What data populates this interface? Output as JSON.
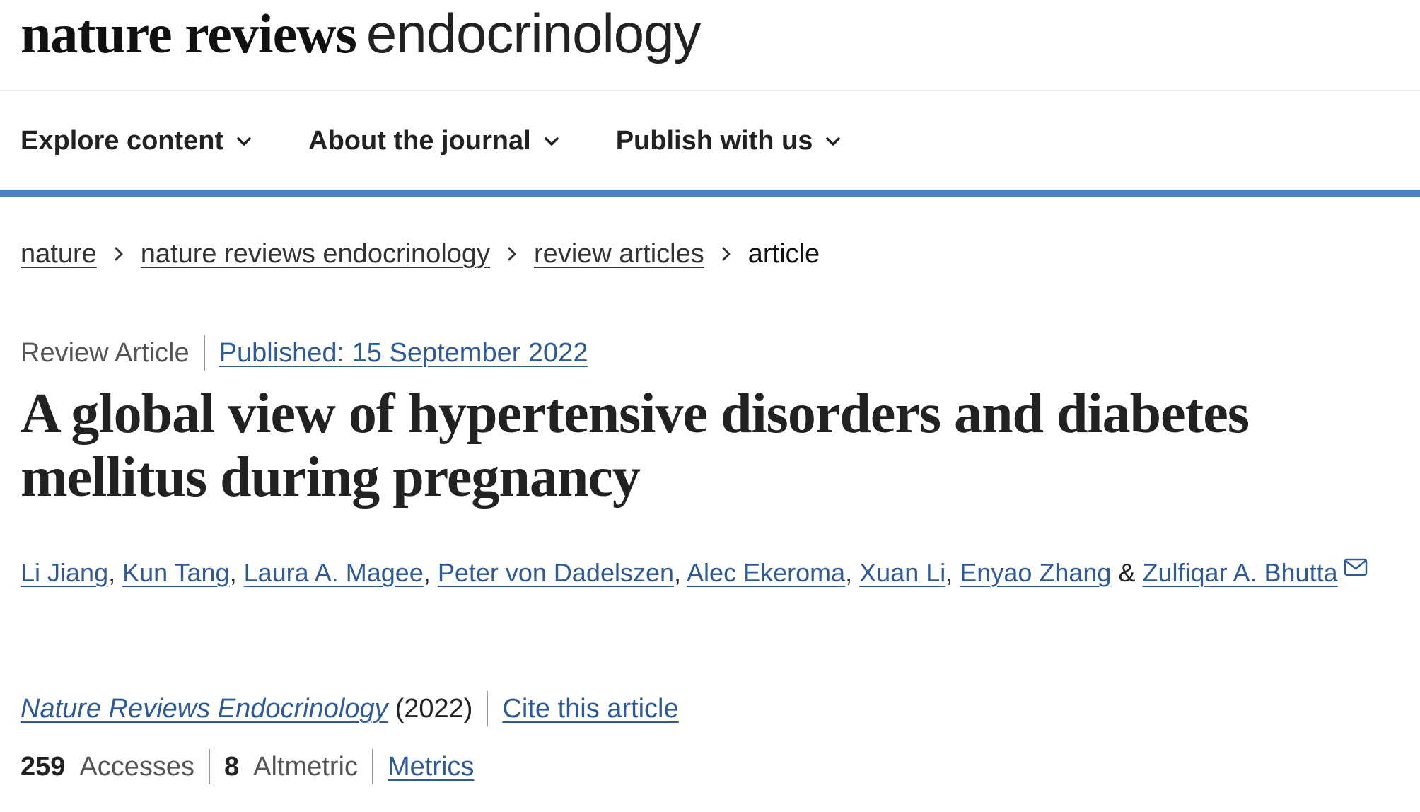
{
  "logo": {
    "bold": "nature reviews",
    "light": "endocrinology"
  },
  "nav": {
    "items": [
      {
        "label": "Explore content",
        "icon": "chevron-down-icon"
      },
      {
        "label": "About the journal",
        "icon": "chevron-down-icon"
      },
      {
        "label": "Publish with us",
        "icon": "chevron-down-icon"
      }
    ]
  },
  "colors": {
    "accent_bar": "#4a7fc4",
    "link": "#2f5a9a",
    "muted_text": "#555555"
  },
  "breadcrumb": {
    "items": [
      {
        "label": "nature"
      },
      {
        "label": "nature reviews endocrinology"
      },
      {
        "label": "review articles"
      }
    ],
    "current": "article"
  },
  "article": {
    "type": "Review Article",
    "published": "Published: 15 September 2022",
    "title": "A global view of hypertensive disorders and diabetes mellitus during pregnancy",
    "authors": [
      "Li Jiang",
      "Kun Tang",
      "Laura A. Magee",
      "Peter von Dadelszen",
      "Alec Ekeroma",
      "Xuan Li",
      "Enyao Zhang",
      "Zulfiqar A. Bhutta"
    ],
    "author_separator": ", ",
    "author_conjunction": " & ",
    "corresponding_icon": "mail-icon",
    "journal": "Nature Reviews Endocrinology",
    "year": "(2022)",
    "cite_label": "Cite this article",
    "metrics": {
      "accesses_count": "259",
      "accesses_label": "Accesses",
      "altmetric_count": "8",
      "altmetric_label": "Altmetric",
      "metrics_link": "Metrics"
    }
  }
}
